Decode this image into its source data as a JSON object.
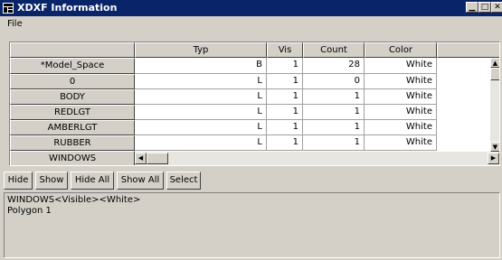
{
  "window": {
    "title": "XDXF Information"
  },
  "menu": {
    "file": "File"
  },
  "table": {
    "columns": [
      "Typ",
      "Vis",
      "Count",
      "Color",
      ""
    ],
    "rows": [
      {
        "name": "*Model_Space",
        "typ": "B",
        "vis": "1",
        "count": "28",
        "color": "White"
      },
      {
        "name": "0",
        "typ": "L",
        "vis": "1",
        "count": "0",
        "color": "White"
      },
      {
        "name": "BODY",
        "typ": "L",
        "vis": "1",
        "count": "1",
        "color": "White"
      },
      {
        "name": "REDLGT",
        "typ": "L",
        "vis": "1",
        "count": "1",
        "color": "White"
      },
      {
        "name": "AMBERLGT",
        "typ": "L",
        "vis": "1",
        "count": "1",
        "color": "White"
      },
      {
        "name": "RUBBER",
        "typ": "L",
        "vis": "1",
        "count": "1",
        "color": "White"
      },
      {
        "name": "WINDOWS",
        "typ": "",
        "vis": "",
        "count": "",
        "color": ""
      }
    ]
  },
  "buttons": {
    "hide": "Hide",
    "show": "Show",
    "hide_all": "Hide All",
    "show_all": "Show All",
    "select": "Select"
  },
  "output": {
    "lines": [
      "WINDOWS<Visible><White>",
      "Polygon 1"
    ]
  },
  "colors": {
    "titlebar": "#0a246a",
    "face": "#d4d0c8"
  }
}
